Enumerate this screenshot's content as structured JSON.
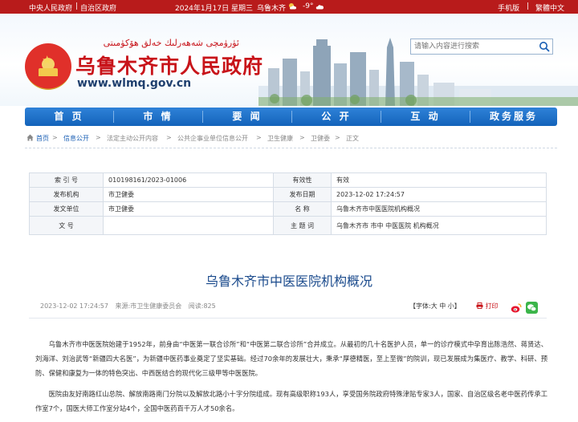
{
  "topbar": {
    "link_central": "中央人民政府",
    "link_region": "自治区政府",
    "date": "2024年1月17日 星期三",
    "city": "乌鲁木齐",
    "temperature": "-9°",
    "mobile": "手机版",
    "traditional": "繁體中文"
  },
  "header": {
    "uyghur_text": "ئۈرۈمچى شەھەرلىك خەلق ھۆكۈمىتى",
    "title": "乌鲁木齐市人民政府",
    "url": "www.wlmq.gov.cn",
    "search_placeholder": "请输入内容进行搜索"
  },
  "nav": {
    "items": [
      "首 页",
      "市 情",
      "要 闻",
      "公 开",
      "互 动",
      "政务服务"
    ]
  },
  "breadcrumb": {
    "items": [
      "首页",
      "信息公开",
      "法定主动公开内容",
      "公共企事业单位信息公开",
      "卫生健康",
      "卫健委",
      "正文"
    ],
    "sep": ">"
  },
  "info": {
    "index_label": "索 引 号",
    "index_value": "010198161/2023-01006",
    "validity_label": "有效性",
    "validity_value": "有效",
    "issuer_label": "发布机构",
    "issuer_value": "市卫健委",
    "date_label": "发布日期",
    "date_value": "2023-12-02 17:24:57",
    "unit_label": "发文单位",
    "unit_value": "市卫健委",
    "name_label": "名 称",
    "name_value": "乌鲁木齐市中医医院机构概况",
    "doc_label": "文 号",
    "doc_value": "",
    "topic_label": "主 题 词",
    "topic_value": "乌鲁木齐市 市中 中医医院 机构概况"
  },
  "article": {
    "title": "乌鲁木齐市中医医院机构概况",
    "date": "2023-12-02 17:24:57",
    "source": "来源:市卫生健康委员会",
    "views": "阅读:825",
    "font_label": "【字体:大  中  小】",
    "print": "打印",
    "para1": "乌鲁木齐市中医医院始建于1952年，前身由“中医第一联合诊所”和“中医第二联合诊所”合并成立。从最初的几十名医护人员，单一的诊疗模式中孕育出陈浩然、蒋贤达、刘海洋、刘治武等“新疆四大名医”，为新疆中医药事业奠定了坚实基础。经过70余年的发展壮大，秉承“厚德精医，至上至微”的院训，现已发展成为集医疗、教学、科研、预防、保健和康复为一体的特色突出、中西医结合的现代化三级甲等中医医院。",
    "para2": "医院由友好南路红山总院、解放南路南门分院以及解放北路小十字分院组成。现有高级职称193人，享受国务院政府特殊津贴专家3人，国家、自治区级名老中医药传承工作室7个，国医大师工作室分站4个，全国中医药百千万人才50余名。"
  },
  "colors": {
    "topbar": "#b81b1b",
    "title_red": "#c8141a",
    "nav_blue": "#1a6cc4",
    "article_title": "#1a4a8c"
  }
}
